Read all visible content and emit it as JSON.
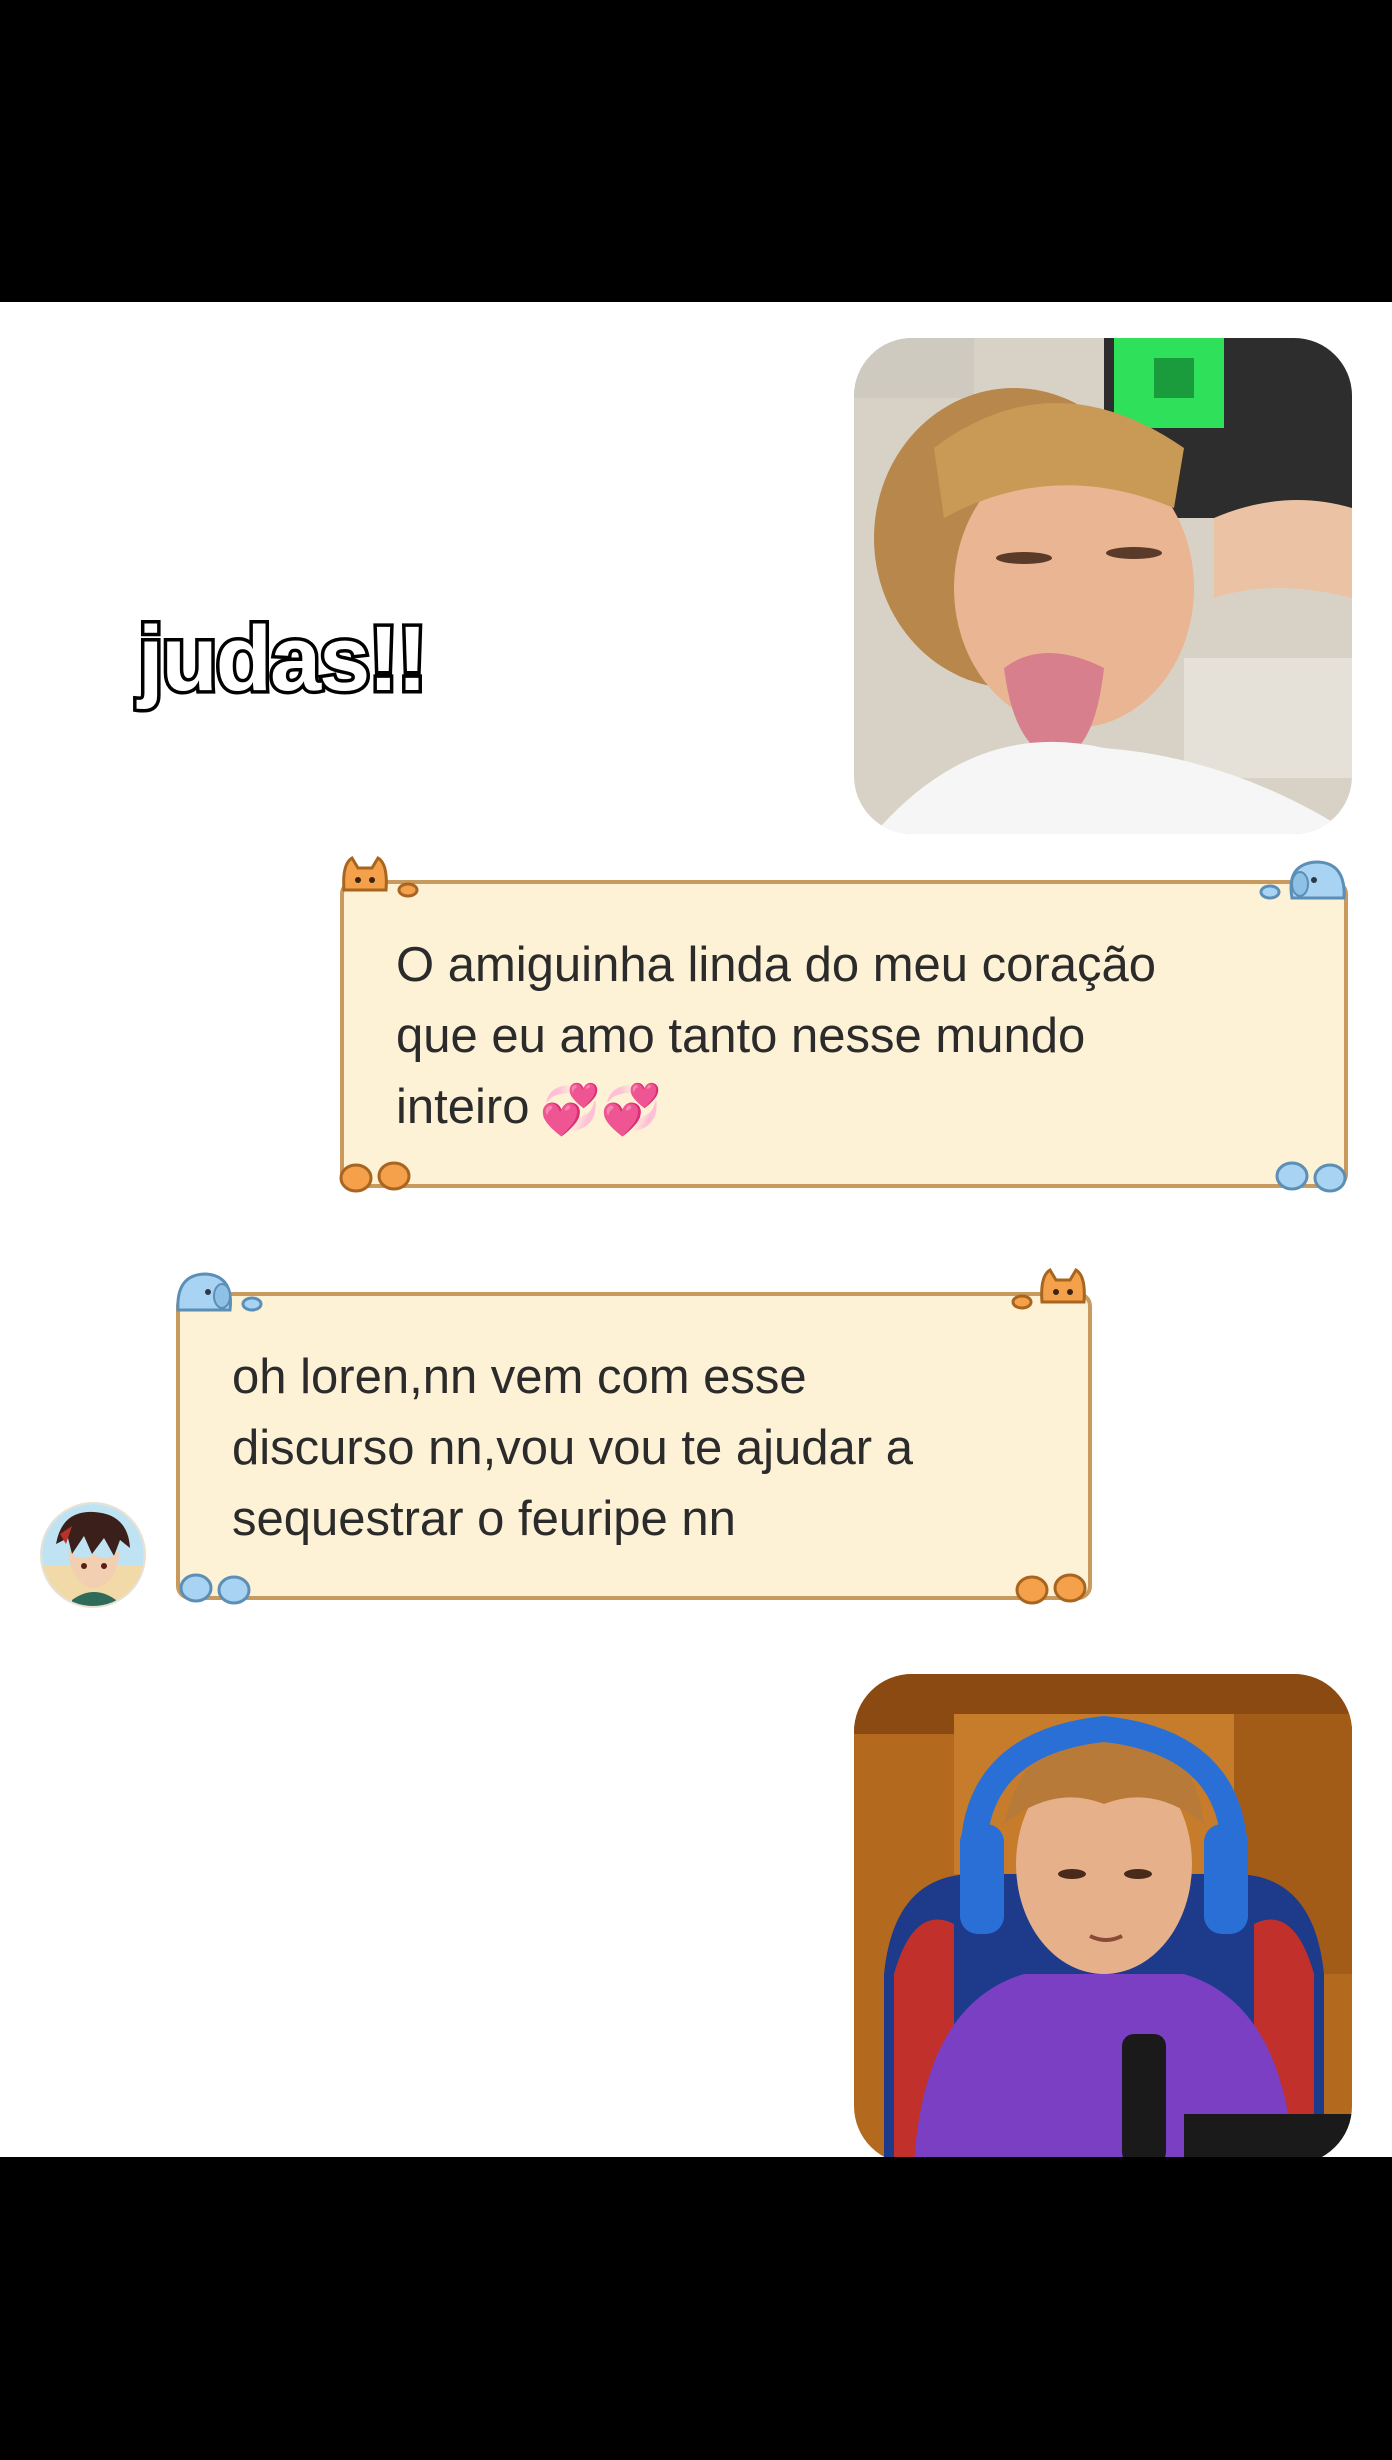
{
  "caption": {
    "text": "judas!!"
  },
  "messages": [
    {
      "side": "right",
      "type": "image",
      "icon": "photo-laughing-boy"
    },
    {
      "side": "right",
      "type": "text",
      "lines": [
        "O amiguinha linda do meu coração",
        "que eu amo tanto nesse mundo",
        "inteiro"
      ],
      "emoji": "💞💞"
    },
    {
      "side": "left",
      "type": "text",
      "lines": [
        "oh loren,nn vem com esse",
        "discurso nn,vou vou te ajudar a",
        "sequestrar o feuripe nn"
      ],
      "avatar_icon": "anime-avatar"
    },
    {
      "side": "right",
      "type": "image",
      "icon": "photo-boy-headset"
    }
  ],
  "colors": {
    "bubble_bg": "#fdf1d6",
    "bubble_border": "#c99a5d",
    "accent_orange": "#f5a04a",
    "accent_blue": "#a9d3f2"
  }
}
